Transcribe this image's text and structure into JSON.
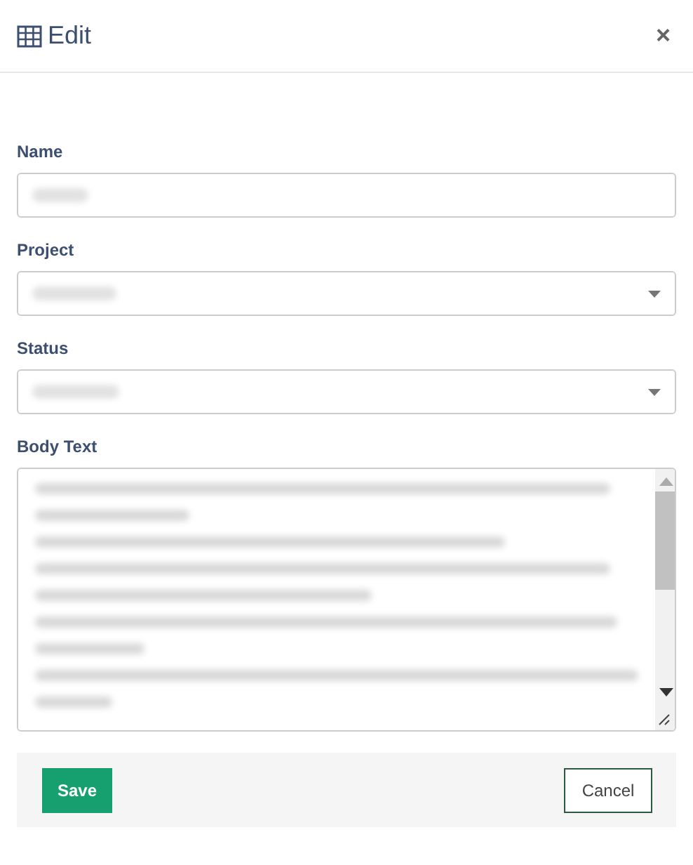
{
  "dialog": {
    "title": "Edit",
    "close": "×"
  },
  "fields": [
    {
      "kind": "text",
      "label": "Name",
      "redacted": true
    },
    {
      "kind": "select",
      "label": "Project",
      "redacted": true
    },
    {
      "kind": "select",
      "label": "Status",
      "redacted": true
    },
    {
      "kind": "textarea",
      "label": "Body Text",
      "redacted": true
    }
  ],
  "buttons": [
    {
      "kind": "primary",
      "label": "Save"
    },
    {
      "kind": "secondary",
      "label": "Cancel"
    }
  ]
}
